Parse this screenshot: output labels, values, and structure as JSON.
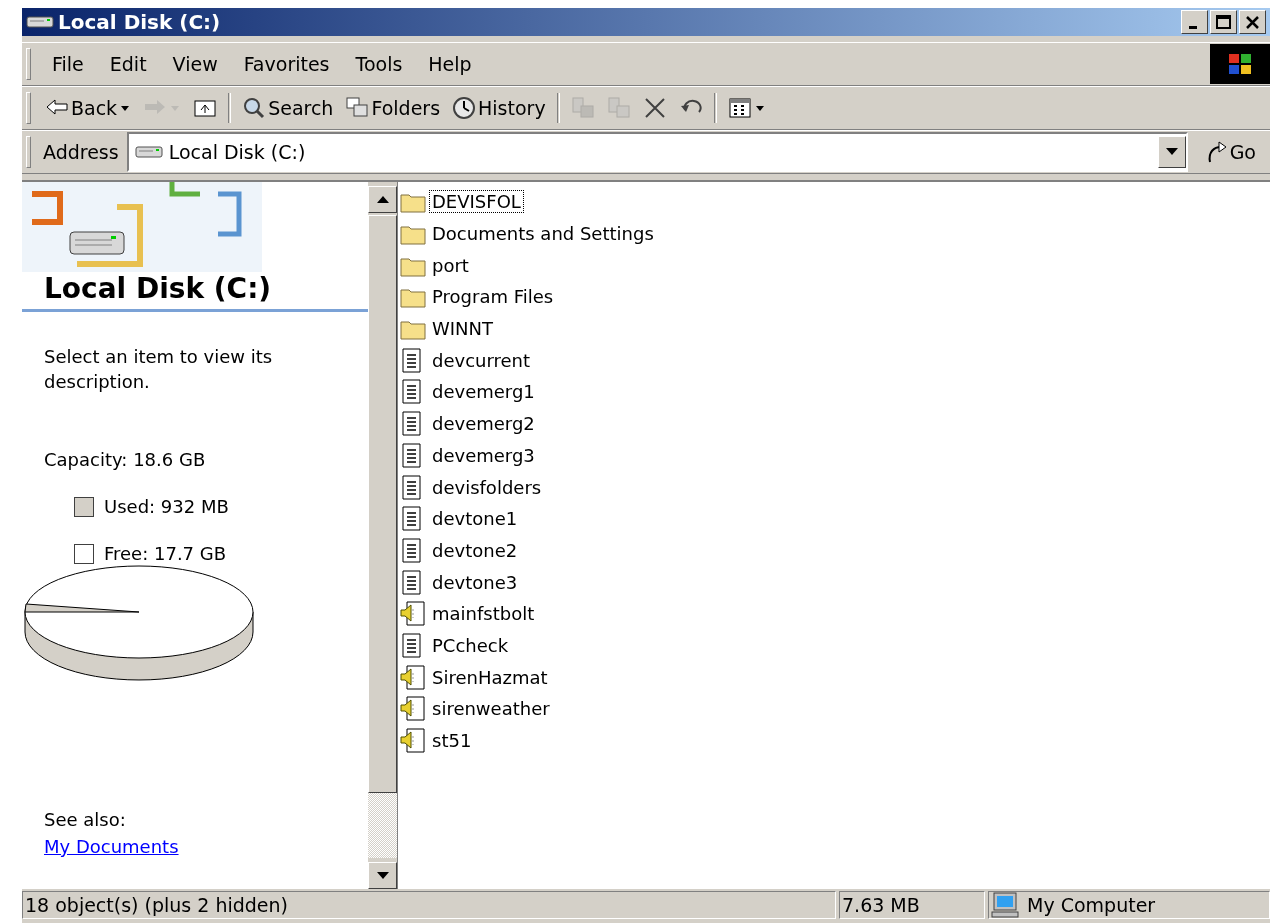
{
  "window": {
    "title": "Local Disk (C:)"
  },
  "menu": [
    "File",
    "Edit",
    "View",
    "Favorites",
    "Tools",
    "Help"
  ],
  "toolbar": [
    {
      "kind": "back",
      "label": "Back",
      "dropdown": true,
      "disabled": false
    },
    {
      "kind": "forward",
      "dropdown": true,
      "disabled": true
    },
    {
      "kind": "up",
      "disabled": false
    },
    {
      "kind": "separator"
    },
    {
      "kind": "search",
      "label": "Search",
      "disabled": false
    },
    {
      "kind": "folders",
      "label": "Folders",
      "disabled": false
    },
    {
      "kind": "history",
      "label": "History",
      "disabled": false
    },
    {
      "kind": "separator"
    },
    {
      "kind": "move",
      "disabled": true
    },
    {
      "kind": "copy",
      "disabled": true
    },
    {
      "kind": "delete",
      "disabled": false
    },
    {
      "kind": "undo",
      "disabled": false
    },
    {
      "kind": "separator"
    },
    {
      "kind": "views",
      "dropdown": true,
      "disabled": false
    }
  ],
  "address": {
    "label": "Address",
    "value": "Local Disk (C:)",
    "go": "Go"
  },
  "info_pane": {
    "title": "Local Disk (C:)",
    "description": "Select an item to view its description.",
    "capacity": "Capacity: 18.6 GB",
    "legend": [
      {
        "label": "Used: 932 MB",
        "color": "#d4d0c8"
      },
      {
        "label": "Free: 17.7 GB",
        "color": "#ffffff"
      }
    ],
    "see_also": "See also:",
    "links": [
      "My Documents"
    ]
  },
  "files": [
    {
      "name": "DEVISFOL",
      "kind": "folder",
      "focused": true
    },
    {
      "name": "Documents and Settings",
      "kind": "folder",
      "focused": false
    },
    {
      "name": "port",
      "kind": "folder",
      "focused": false
    },
    {
      "name": "Program Files",
      "kind": "folder",
      "focused": false
    },
    {
      "name": "WINNT",
      "kind": "folder",
      "focused": false
    },
    {
      "name": "devcurrent",
      "kind": "document",
      "focused": false
    },
    {
      "name": "devemerg1",
      "kind": "document",
      "focused": false
    },
    {
      "name": "devemerg2",
      "kind": "document",
      "focused": false
    },
    {
      "name": "devemerg3",
      "kind": "document",
      "focused": false
    },
    {
      "name": "devisfolders",
      "kind": "document",
      "focused": false
    },
    {
      "name": "devtone1",
      "kind": "document",
      "focused": false
    },
    {
      "name": "devtone2",
      "kind": "document",
      "focused": false
    },
    {
      "name": "devtone3",
      "kind": "document",
      "focused": false
    },
    {
      "name": "mainfstbolt",
      "kind": "sound",
      "focused": false
    },
    {
      "name": "PCcheck",
      "kind": "document",
      "focused": false
    },
    {
      "name": "SirenHazmat",
      "kind": "sound",
      "focused": false
    },
    {
      "name": "sirenweather",
      "kind": "sound",
      "focused": false
    },
    {
      "name": "st51",
      "kind": "sound",
      "focused": false
    }
  ],
  "status_bar": {
    "objects": "18 object(s) (plus 2 hidden)",
    "size": "7.63 MB",
    "zone": "My Computer"
  }
}
